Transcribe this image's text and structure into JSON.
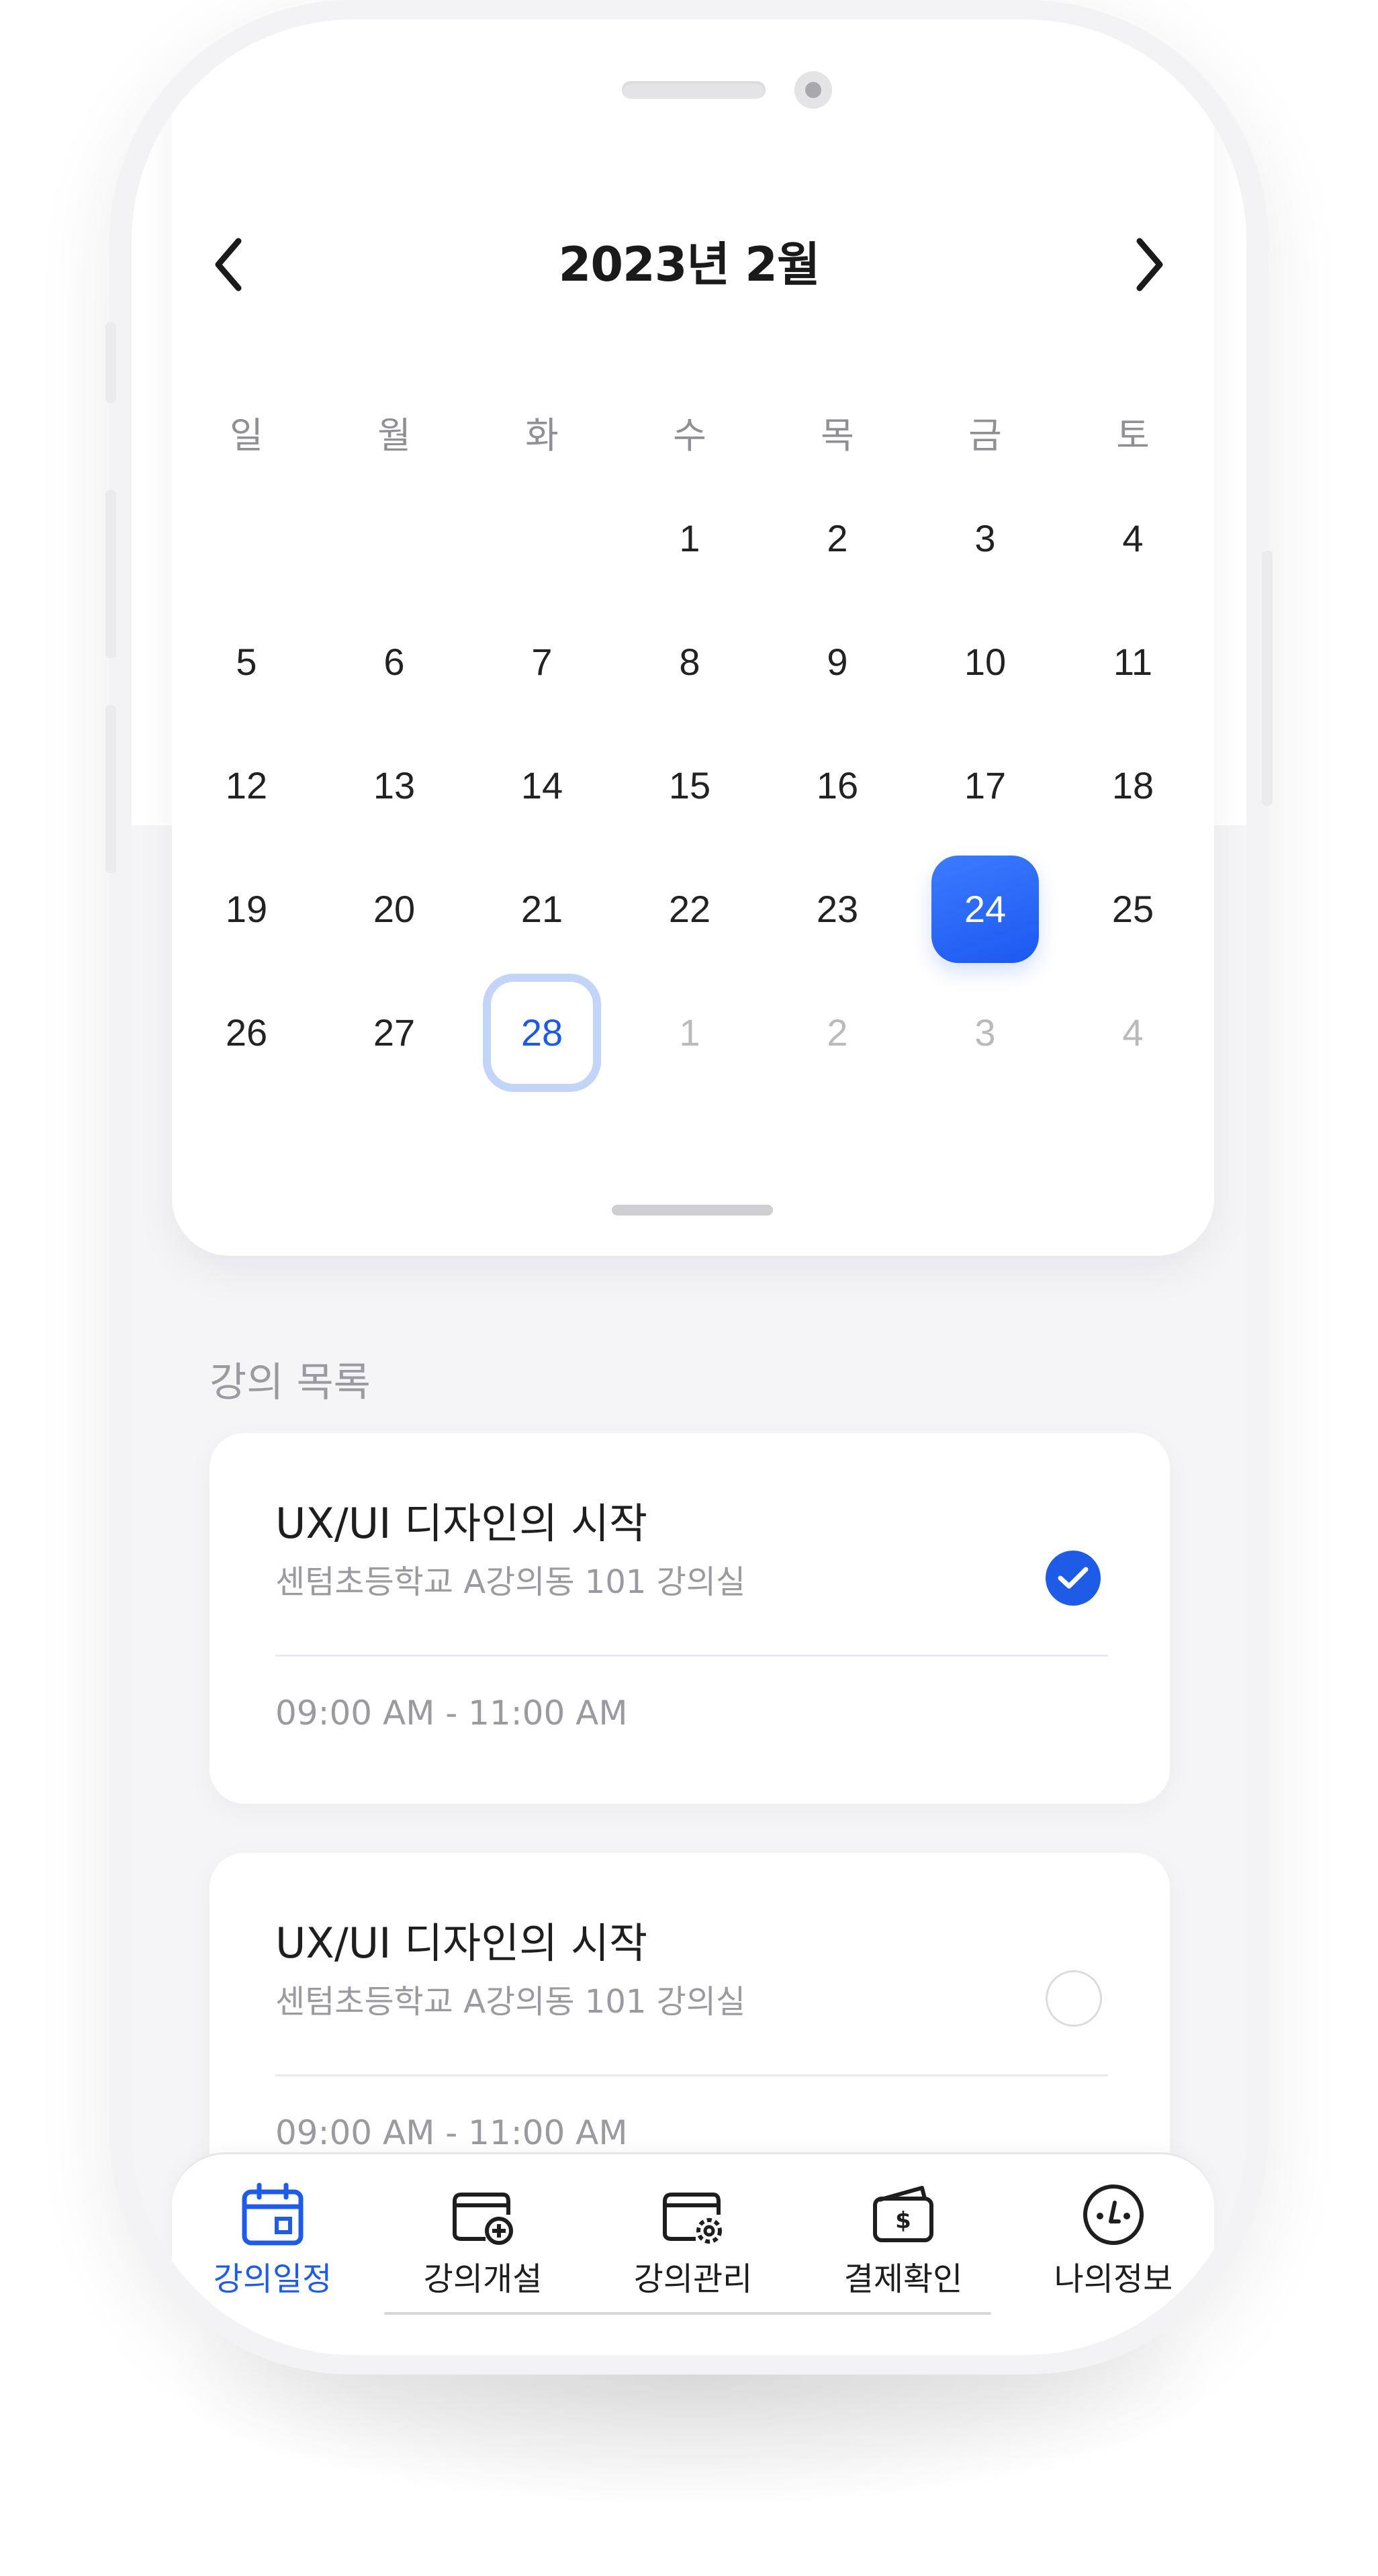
{
  "calendar": {
    "month_title": "2023년 2월",
    "weekdays": [
      "일",
      "월",
      "화",
      "수",
      "목",
      "금",
      "토"
    ],
    "weeks": [
      [
        {
          "d": ""
        },
        {
          "d": ""
        },
        {
          "d": ""
        },
        {
          "d": "1"
        },
        {
          "d": "2"
        },
        {
          "d": "3"
        },
        {
          "d": "4"
        }
      ],
      [
        {
          "d": "5"
        },
        {
          "d": "6"
        },
        {
          "d": "7"
        },
        {
          "d": "8"
        },
        {
          "d": "9"
        },
        {
          "d": "10"
        },
        {
          "d": "11"
        }
      ],
      [
        {
          "d": "12"
        },
        {
          "d": "13"
        },
        {
          "d": "14"
        },
        {
          "d": "15"
        },
        {
          "d": "16"
        },
        {
          "d": "17"
        },
        {
          "d": "18"
        }
      ],
      [
        {
          "d": "19"
        },
        {
          "d": "20"
        },
        {
          "d": "21"
        },
        {
          "d": "22"
        },
        {
          "d": "23"
        },
        {
          "d": "24",
          "state": "selected"
        },
        {
          "d": "25"
        }
      ],
      [
        {
          "d": "26"
        },
        {
          "d": "27"
        },
        {
          "d": "28",
          "state": "today"
        },
        {
          "d": "1",
          "state": "other"
        },
        {
          "d": "2",
          "state": "other"
        },
        {
          "d": "3",
          "state": "other"
        },
        {
          "d": "4",
          "state": "other"
        }
      ]
    ],
    "prev_icon": "chevron-left-icon",
    "next_icon": "chevron-right-icon"
  },
  "lectures": {
    "section_title": "강의 목록",
    "items": [
      {
        "title": "UX/UI 디자인의 시작",
        "place": "센텀초등학교 A강의동 101 강의실",
        "time": "09:00 AM - 11:00 AM",
        "checked": true
      },
      {
        "title": "UX/UI 디자인의 시작",
        "place": "센텀초등학교 A강의동 101 강의실",
        "time": "09:00 AM - 11:00 AM",
        "checked": false
      }
    ]
  },
  "tabbar": {
    "items": [
      {
        "label": "강의일정",
        "icon": "calendar-icon",
        "active": true
      },
      {
        "label": "강의개설",
        "icon": "wallet-add-icon",
        "active": false
      },
      {
        "label": "강의관리",
        "icon": "wallet-settings-icon",
        "active": false
      },
      {
        "label": "결제확인",
        "icon": "wallet-dollar-icon",
        "active": false
      },
      {
        "label": "나의정보",
        "icon": "profile-icon",
        "active": false
      }
    ]
  },
  "colors": {
    "accent": "#1E5BE6",
    "selected_day_bg": "#2A68F5",
    "today_ring": "#C3D4F9",
    "muted_text": "#9A9AA0",
    "screen_bg": "#F5F5F8"
  }
}
